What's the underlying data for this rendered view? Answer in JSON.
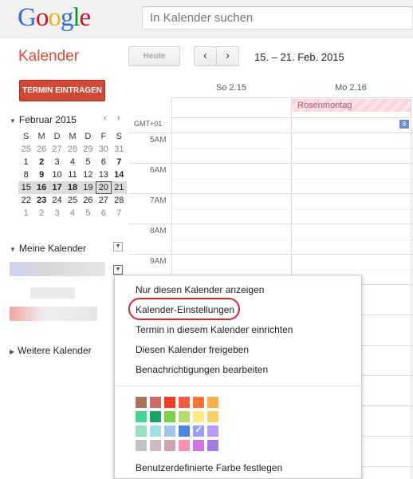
{
  "header": {
    "logo": {
      "letters": [
        "G",
        "o",
        "o",
        "g",
        "l",
        "e"
      ],
      "colors": [
        "#3369e8",
        "#d50f25",
        "#eeb211",
        "#3369e8",
        "#009925",
        "#d50f25"
      ]
    },
    "search_placeholder": "In Kalender suchen"
  },
  "toolbar": {
    "app_name": "Kalender",
    "today_label": "Heute",
    "prev_icon": "‹",
    "next_icon": "›",
    "date_range": "15. – 21. Feb. 2015"
  },
  "sidebar": {
    "create_label": "TERMIN EINTRAGEN",
    "mini_calendar": {
      "title": "Februar 2015",
      "prev": "‹",
      "next": "›",
      "weekdays": [
        "S",
        "M",
        "D",
        "M",
        "D",
        "F",
        "S"
      ],
      "weeks": [
        [
          "25",
          "26",
          "27",
          "28",
          "29",
          "30",
          "31"
        ],
        [
          "1",
          "2",
          "3",
          "4",
          "5",
          "6",
          "7"
        ],
        [
          "8",
          "9",
          "10",
          "11",
          "12",
          "13",
          "14"
        ],
        [
          "15",
          "16",
          "17",
          "18",
          "19",
          "20",
          "21"
        ],
        [
          "22",
          "23",
          "24",
          "25",
          "26",
          "27",
          "28"
        ],
        [
          "1",
          "2",
          "3",
          "4",
          "5",
          "6",
          "7"
        ]
      ]
    },
    "my_calendars_label": "Meine Kalender",
    "other_calendars_label": "Weitere Kalender"
  },
  "calendar": {
    "days": [
      "So 2.15",
      "Mo 2.16"
    ],
    "timezone": "GMT+01",
    "all_day_event": "Rosenmontag",
    "badge": "8",
    "hours": [
      "5AM",
      "6AM",
      "7AM",
      "8AM",
      "9AM"
    ]
  },
  "context_menu": {
    "items": [
      "Nur diesen Kalender anzeigen",
      "Kalender-Einstellungen",
      "Termin in diesem Kalender einrichten",
      "Diesen Kalender freigeben",
      "Benachrichtigungen bearbeiten"
    ],
    "custom_color_label": "Benutzerdefinierte Farbe festlegen",
    "colors": [
      [
        "#ac725e",
        "#d06b64",
        "#f83a22",
        "#fa573c",
        "#ff7537",
        "#ffad46"
      ],
      [
        "#42d692",
        "#16a765",
        "#7bd148",
        "#b3dc6c",
        "#fbe983",
        "#fad165"
      ],
      [
        "#92e1c0",
        "#9fe1e7",
        "#9fc6e7",
        "#4986e7",
        "#9a9cff",
        "#b99aff"
      ],
      [
        "#c2c2c2",
        "#cabdbf",
        "#cca6ac",
        "#f691b2",
        "#cd74e6",
        "#a47ae2"
      ]
    ],
    "selected_color": "#9a9cff"
  }
}
